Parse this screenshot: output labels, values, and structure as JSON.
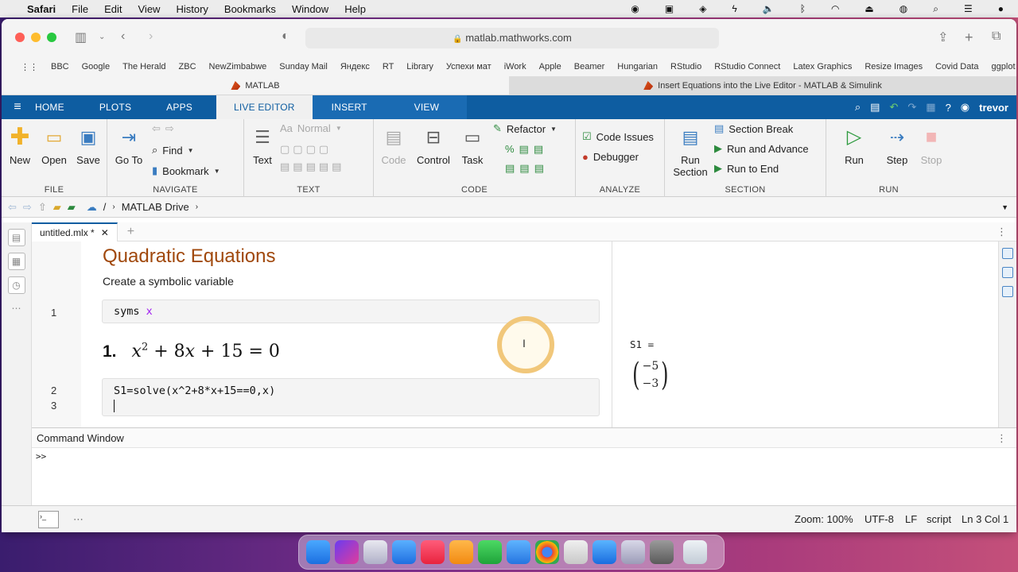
{
  "menubar": {
    "app": "Safari",
    "items": [
      "File",
      "Edit",
      "View",
      "History",
      "Bookmarks",
      "Window",
      "Help"
    ]
  },
  "browser": {
    "url": "matlab.mathworks.com",
    "favorites": [
      "BBC",
      "Google",
      "The Herald",
      "ZBC",
      "NewZimbabwe",
      "Sunday Mail",
      "Яндекс",
      "RT",
      "Library",
      "Успехи мат",
      "iWork",
      "Apple",
      "Beamer",
      "Hungarian",
      "RStudio",
      "RStudio Connect",
      "Latex Graphics",
      "Resize Images",
      "Covid Data",
      "ggplot"
    ],
    "tabs": [
      {
        "label": "MATLAB",
        "active": true
      },
      {
        "label": "Insert Equations into the Live Editor - MATLAB & Simulink",
        "active": false
      }
    ]
  },
  "ribbon": {
    "tabs": [
      "HOME",
      "PLOTS",
      "APPS",
      "LIVE EDITOR",
      "INSERT",
      "VIEW"
    ],
    "active_tab": "LIVE EDITOR",
    "user": "trevor",
    "file": {
      "label": "FILE",
      "new": "New",
      "open": "Open",
      "save": "Save"
    },
    "navigate": {
      "label": "NAVIGATE",
      "goto": "Go To",
      "find": "Find",
      "bookmark": "Bookmark"
    },
    "text": {
      "label": "TEXT",
      "text": "Text",
      "style": "Normal"
    },
    "code": {
      "label": "CODE",
      "code": "Code",
      "control": "Control",
      "task": "Task",
      "refactor": "Refactor"
    },
    "analyze": {
      "label": "ANALYZE",
      "code_issues": "Code Issues",
      "debugger": "Debugger"
    },
    "section": {
      "label": "SECTION",
      "run_section": "Run Section",
      "section_break": "Section Break",
      "run_advance": "Run and Advance",
      "run_end": "Run to End"
    },
    "run": {
      "label": "RUN",
      "run": "Run",
      "step": "Step",
      "stop": "Stop"
    }
  },
  "address": {
    "root": "/",
    "folder": "MATLAB Drive"
  },
  "editor": {
    "tab": "untitled.mlx *",
    "title": "Quadratic Equations",
    "subtitle": "Create a symbolic variable",
    "line1_code": "syms",
    "line1_var": "x",
    "eq_number": "1.",
    "line2_code": "S1=solve(x^2+8*x+15==0,x)",
    "line_numbers": [
      "1",
      "2",
      "3"
    ]
  },
  "output": {
    "var": "S1 =",
    "values": [
      "−5",
      "−3"
    ]
  },
  "command_window": {
    "title": "Command Window",
    "prompt": ">>"
  },
  "status": {
    "zoom": "Zoom: 100%",
    "encoding": "UTF-8",
    "eol": "LF",
    "type": "script",
    "position": "Ln 3 Col 1"
  }
}
